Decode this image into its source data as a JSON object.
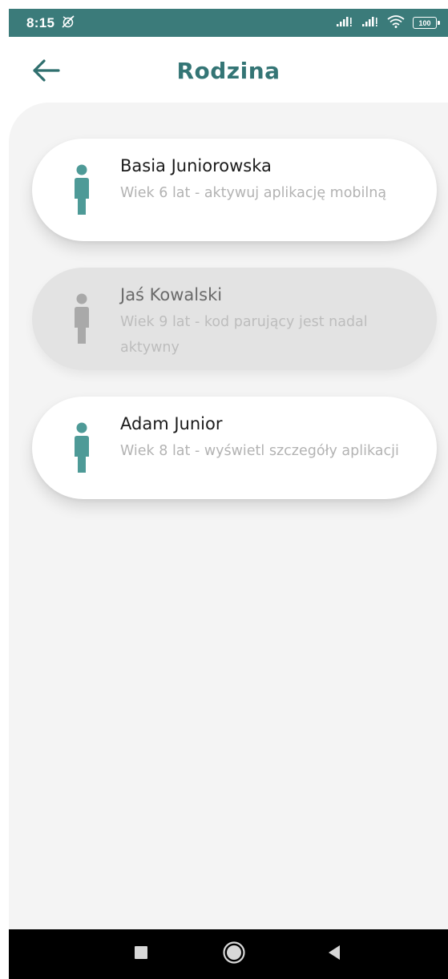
{
  "status_bar": {
    "time": "8:15",
    "battery": "100",
    "icons": [
      "alarm-off-icon",
      "signal-icon",
      "signal-icon",
      "wifi-icon",
      "battery-icon"
    ]
  },
  "header": {
    "title": "Rodzina",
    "back_icon": "arrow-left-icon"
  },
  "children": [
    {
      "name": "Basia Juniorowska",
      "description": "Wiek 6 lat - aktywuj aplikację mobilną",
      "active": true
    },
    {
      "name": "Jaś Kowalski",
      "description": "Wiek 9 lat - kod parujący jest nadal aktywny",
      "active": false
    },
    {
      "name": "Adam Junior",
      "description": "Wiek 8 lat - wyświetl szczegóły aplikacji",
      "active": true
    }
  ],
  "colors": {
    "accent": "#347575",
    "status_bar": "#3b7b7a",
    "person_icon_active": "#4e9a97",
    "person_icon_inactive": "#a9a9a9"
  },
  "nav_bar": {
    "icons": [
      "recents-icon",
      "home-icon",
      "back-icon"
    ]
  }
}
